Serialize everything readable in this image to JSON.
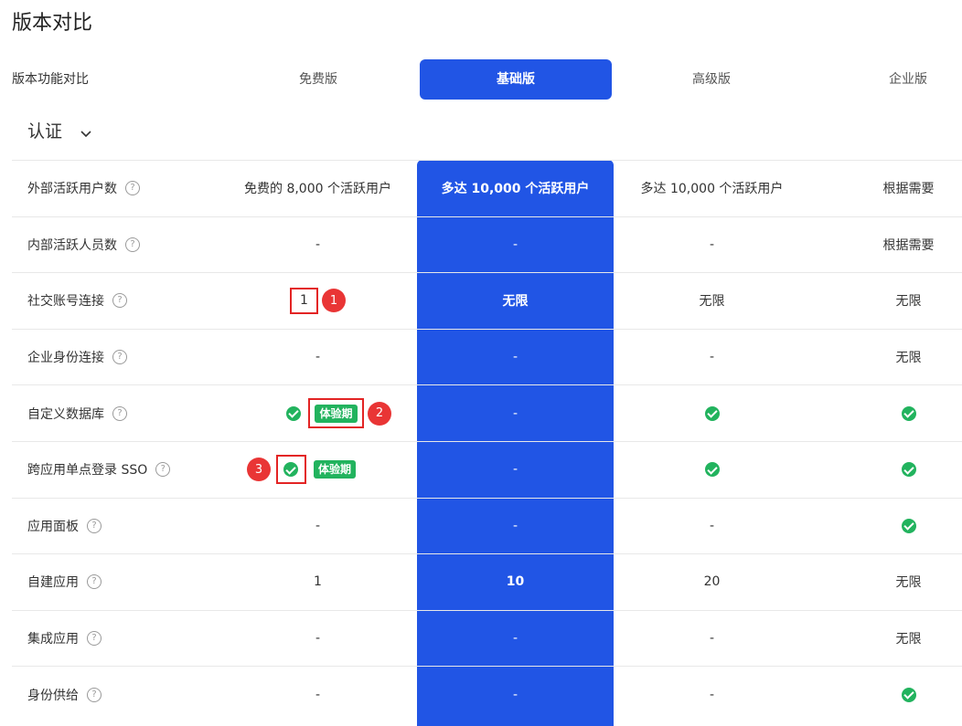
{
  "page_title": "版本对比",
  "header": {
    "label": "版本功能对比",
    "plans": [
      "免费版",
      "基础版",
      "高级版",
      "企业版"
    ],
    "active_plan": "基础版"
  },
  "section": {
    "title": "认证"
  },
  "rows": [
    {
      "feature": "外部活跃用户数",
      "free": "免费的 8,000 个活跃用户",
      "basic": "多达 10,000 个活跃用户",
      "advanced": "多达 10,000 个活跃用户",
      "enterprise": "根据需要"
    },
    {
      "feature": "内部活跃人员数",
      "free": "-",
      "basic": "-",
      "advanced": "-",
      "enterprise": "根据需要"
    },
    {
      "feature": "社交账号连接",
      "free": "1",
      "basic": "无限",
      "advanced": "无限",
      "enterprise": "无限"
    },
    {
      "feature": "企业身份连接",
      "free": "-",
      "basic": "-",
      "advanced": "-",
      "enterprise": "无限"
    },
    {
      "feature": "自定义数据库",
      "free": "check+trial",
      "basic": "-",
      "advanced": "check",
      "enterprise": "check"
    },
    {
      "feature": "跨应用单点登录 SSO",
      "free": "check+trial",
      "basic": "-",
      "advanced": "check",
      "enterprise": "check"
    },
    {
      "feature": "应用面板",
      "free": "-",
      "basic": "-",
      "advanced": "-",
      "enterprise": "check"
    },
    {
      "feature": "自建应用",
      "free": "1",
      "basic": "10",
      "advanced": "20",
      "enterprise": "无限"
    },
    {
      "feature": "集成应用",
      "free": "-",
      "basic": "-",
      "advanced": "-",
      "enterprise": "无限"
    },
    {
      "feature": "身份供给",
      "free": "-",
      "basic": "-",
      "advanced": "-",
      "enterprise": "check"
    }
  ],
  "trial_label": "体验期",
  "annotations": [
    "1",
    "2",
    "3"
  ],
  "icons": {
    "help": "question-circle-icon",
    "check": "check-circle-icon",
    "chevron": "chevron-down-icon"
  },
  "colors": {
    "accent": "#2155e5",
    "success": "#22b35e",
    "annotation": "#e93535"
  }
}
